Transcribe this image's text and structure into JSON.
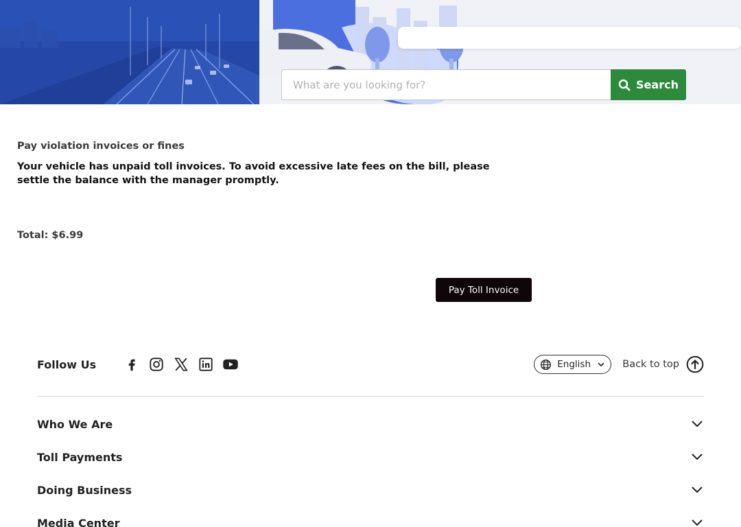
{
  "hero": {
    "search": {
      "placeholder": "What are you looking for?",
      "button_label": "Search"
    }
  },
  "main": {
    "heading": "Pay violation invoices or fines",
    "message": "Your vehicle has unpaid toll invoices. To avoid excessive late fees on the bill, please settle the balance with the manager promptly.",
    "total_label": "Total:",
    "total_value": "$6.99",
    "pay_button": "Pay Toll Invoice"
  },
  "footer": {
    "follow_label": "Follow Us",
    "socials": [
      "facebook-icon",
      "instagram-icon",
      "x-icon",
      "linkedin-icon",
      "youtube-icon"
    ],
    "language": "English",
    "back_to_top": "Back to top",
    "sections": [
      "Who We Are",
      "Toll Payments",
      "Doing Business",
      "Media Center"
    ]
  },
  "colors": {
    "search_green": "#2c8a3a",
    "pay_button": "#0f060a",
    "hero_blue": "#2a54b8"
  }
}
